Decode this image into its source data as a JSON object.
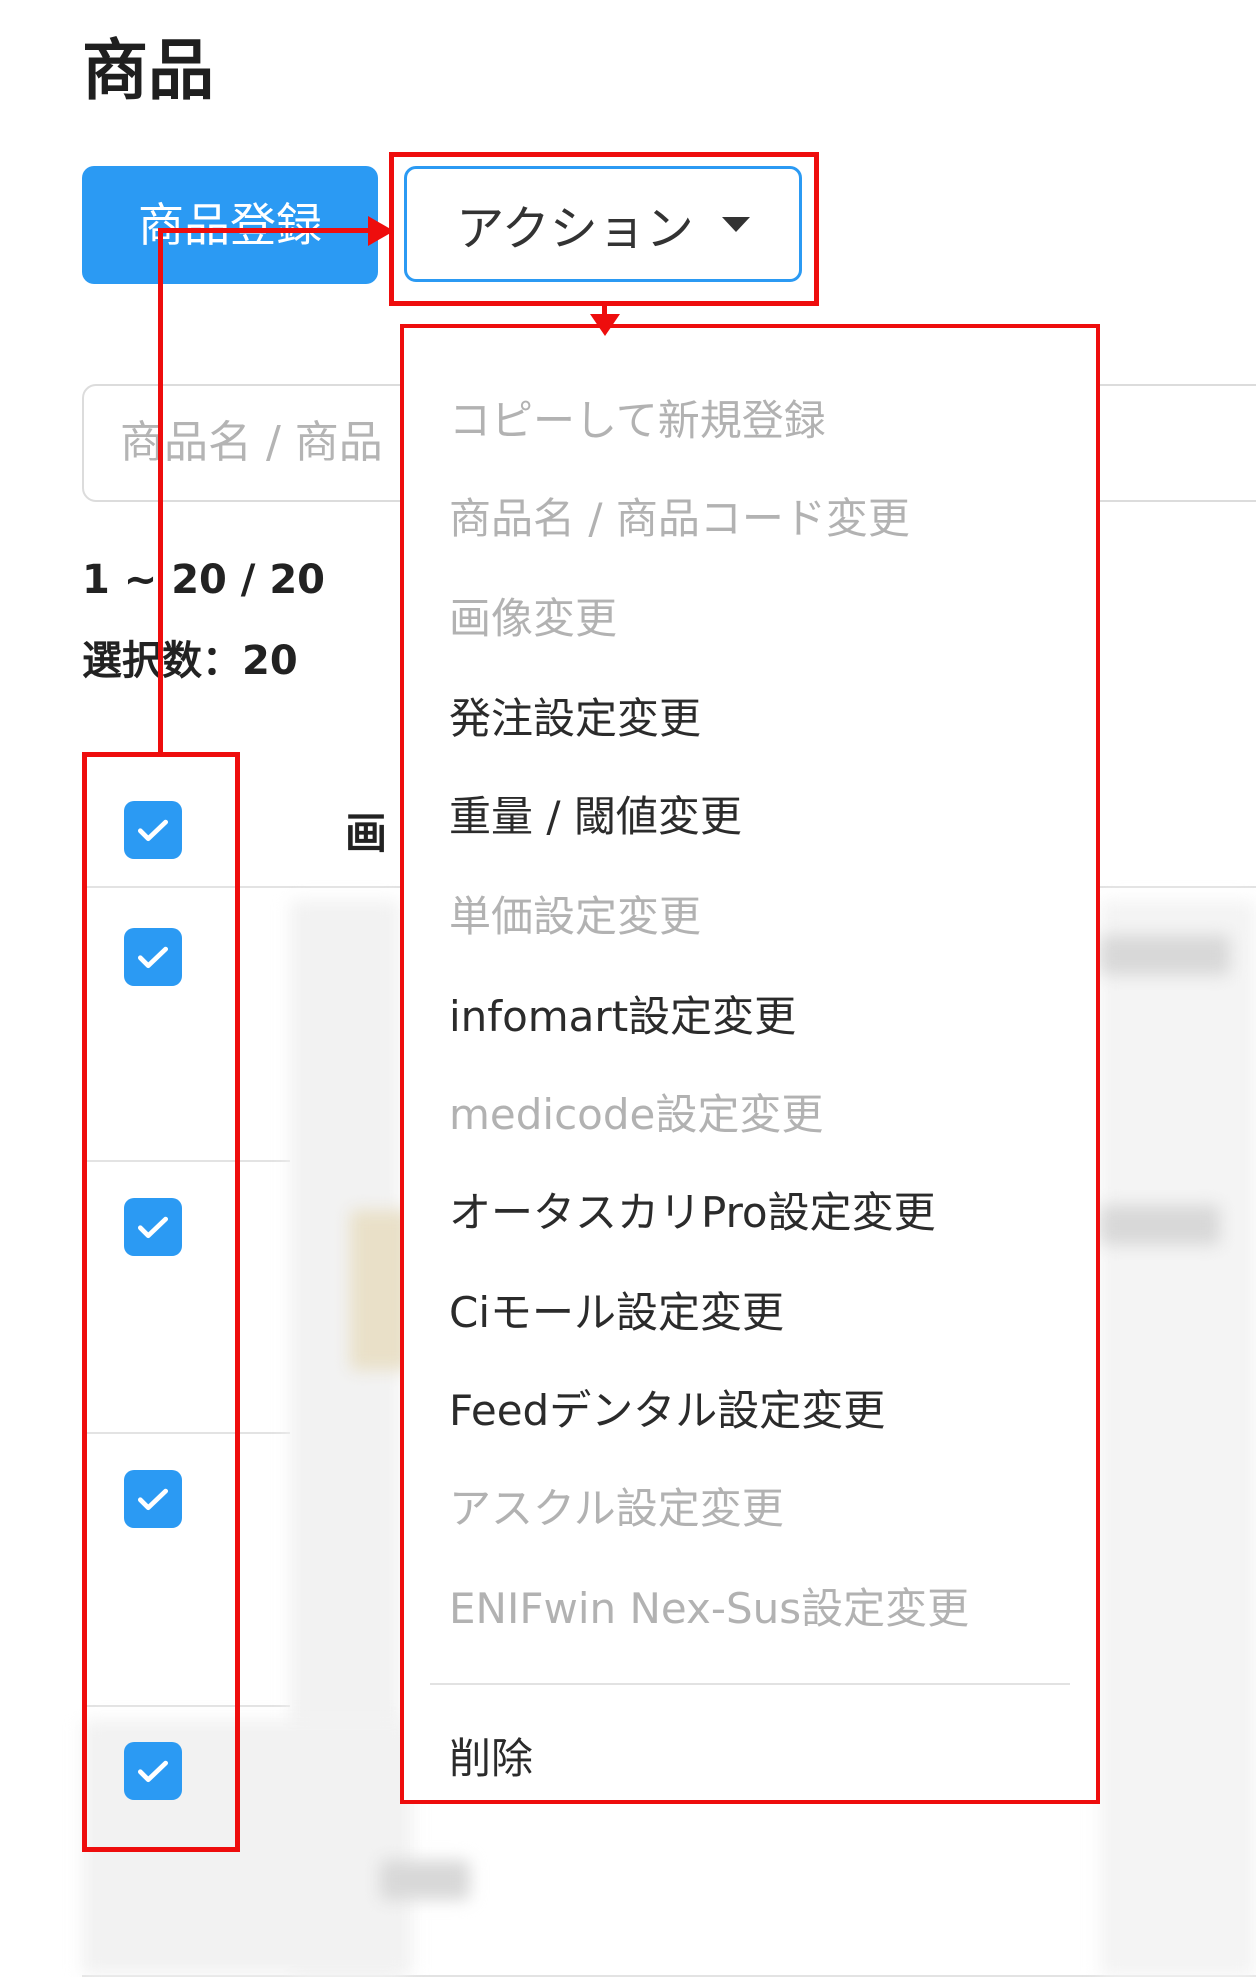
{
  "page": {
    "title": "商品",
    "register_label": "商品登録",
    "action_label": "アクション",
    "search_placeholder": "商品名 / 商品",
    "range_text": "1 ~ 20 / 20",
    "selected_text": "選択数：20",
    "image_column_header": "画"
  },
  "action_menu": {
    "items": [
      {
        "label": "コピーして新規登録",
        "enabled": false
      },
      {
        "label": "商品名 / 商品コード変更",
        "enabled": false
      },
      {
        "label": "画像変更",
        "enabled": false
      },
      {
        "label": "発注設定変更",
        "enabled": true
      },
      {
        "label": "重量 / 閾値変更",
        "enabled": true
      },
      {
        "label": "単価設定変更",
        "enabled": false
      },
      {
        "label": "infomart設定変更",
        "enabled": true
      },
      {
        "label": "medicode設定変更",
        "enabled": false
      },
      {
        "label": "オータスカリPro設定変更",
        "enabled": true
      },
      {
        "label": "Ciモール設定変更",
        "enabled": true
      },
      {
        "label": "Feedデンタル設定変更",
        "enabled": true
      },
      {
        "label": "アスクル設定変更",
        "enabled": false
      },
      {
        "label": "ENIFwin Nex-Sus設定変更",
        "enabled": false
      },
      {
        "label": "削除",
        "enabled": true
      }
    ]
  },
  "checkboxes": {
    "header_checked": true,
    "row_count": 4,
    "rows_checked": true
  },
  "colors": {
    "primary": "#2b9af3",
    "annotation": "#ee0d0d",
    "disabled_text": "#b2b2b2"
  }
}
